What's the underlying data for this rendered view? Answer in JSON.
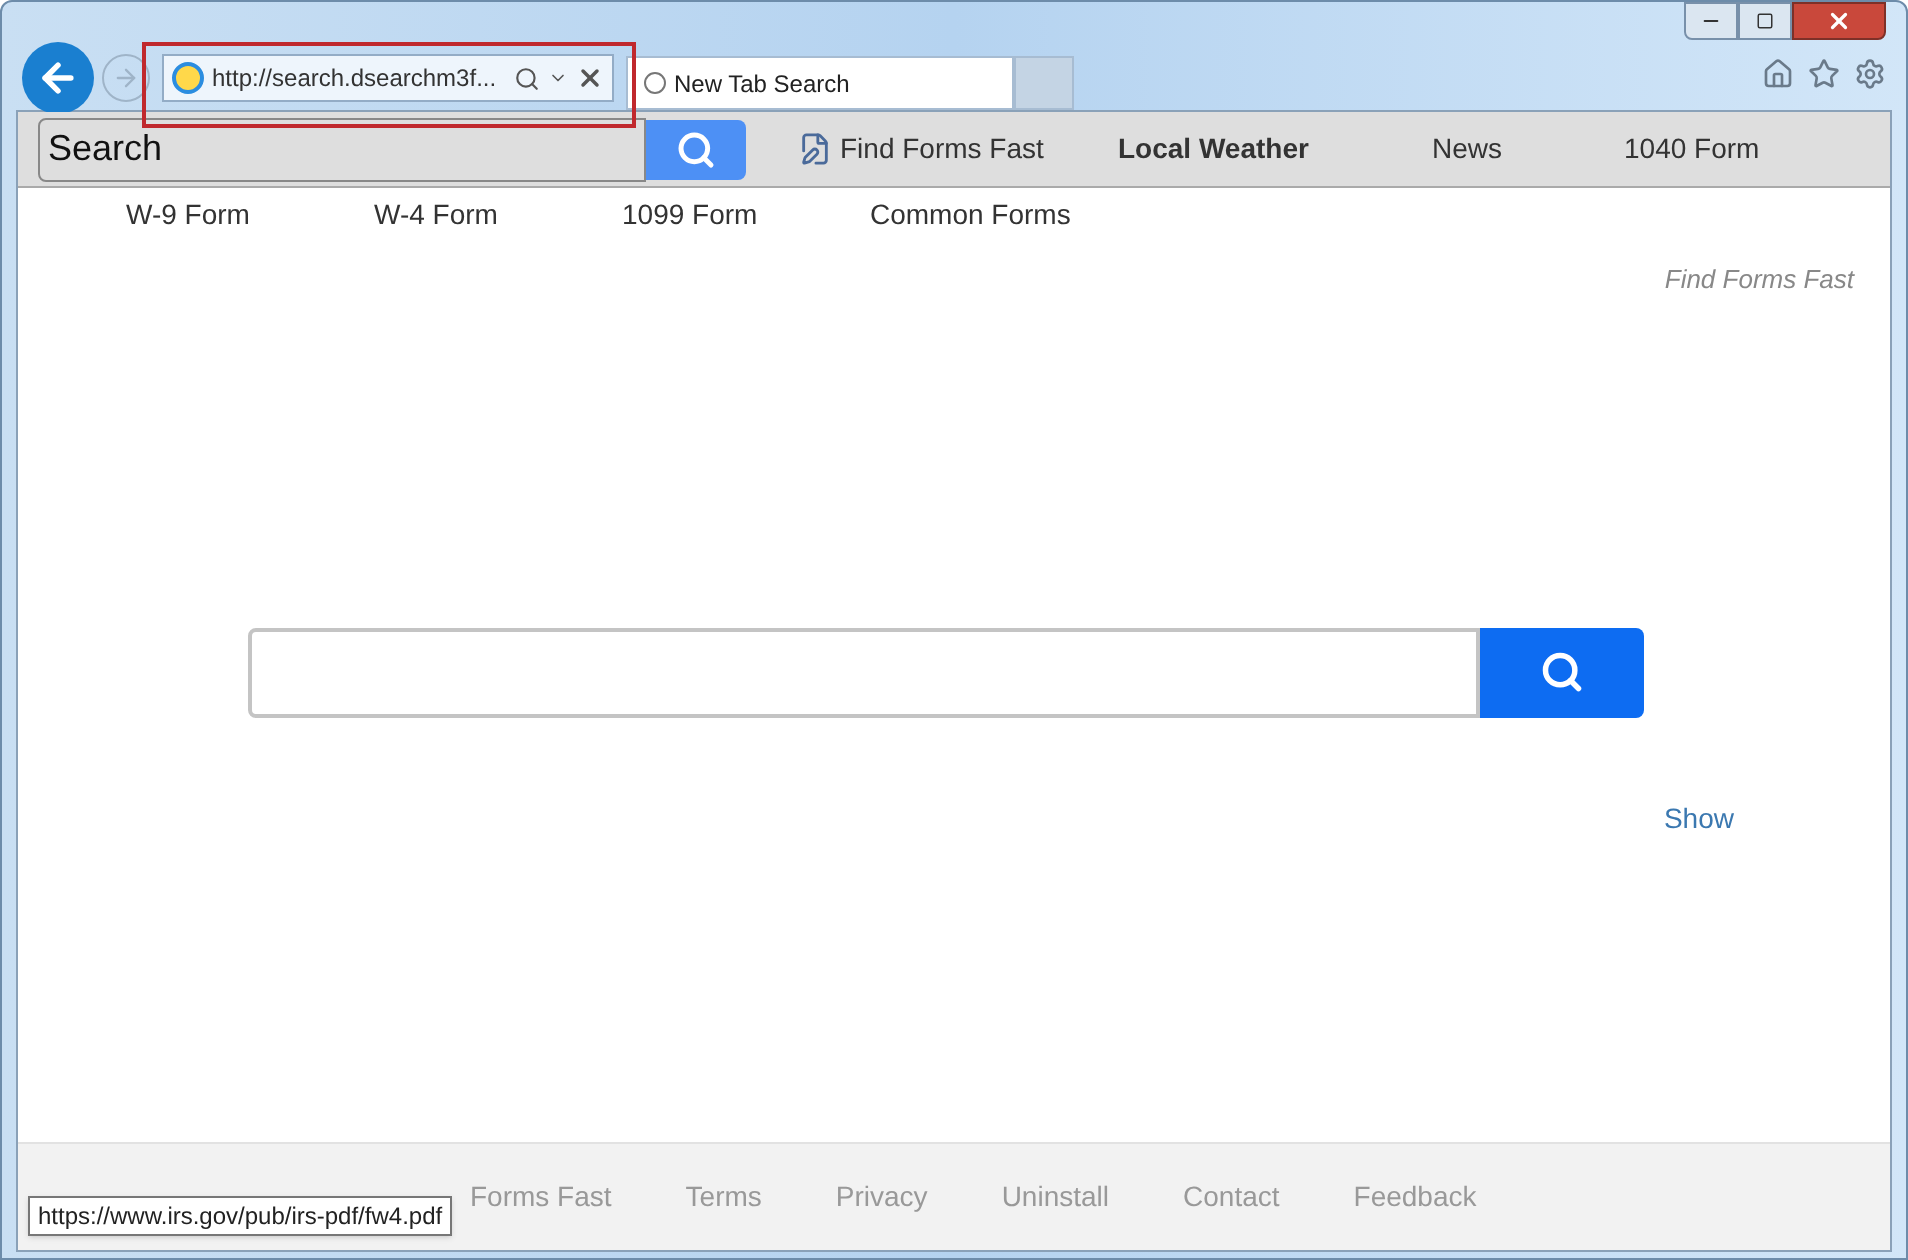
{
  "browser": {
    "address": "http://search.dsearchm3f...",
    "tabs": [
      {
        "title": "New Tab Search",
        "selected": true
      }
    ]
  },
  "toolbar": {
    "search_value": "Search",
    "links": [
      {
        "label": "Find Forms Fast",
        "kind": "icon"
      },
      {
        "label": "Local Weather",
        "kind": "bold"
      },
      {
        "label": "News",
        "kind": "plain"
      },
      {
        "label": "1040 Form",
        "kind": "plain"
      }
    ]
  },
  "form_links": [
    "W-9 Form",
    "W-4 Form",
    "1099 Form",
    "Common Forms"
  ],
  "brand": "Find Forms Fast",
  "show_link": "Show",
  "footer_links": [
    "Forms Fast",
    "Terms",
    "Privacy",
    "Uninstall",
    "Contact",
    "Feedback"
  ],
  "status_tooltip": "https://www.irs.gov/pub/irs-pdf/fw4.pdf"
}
